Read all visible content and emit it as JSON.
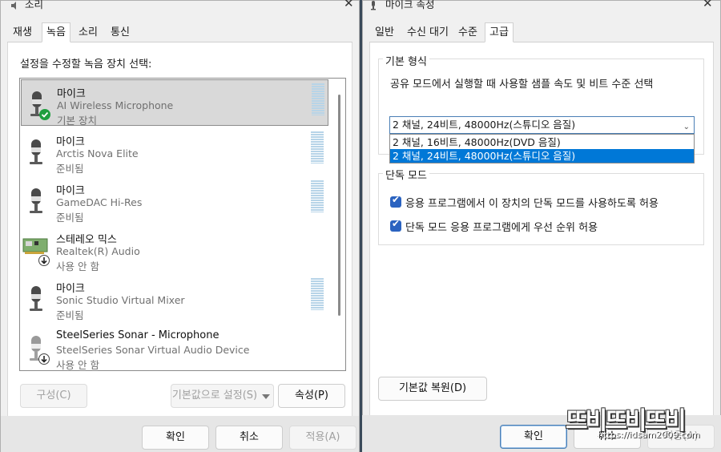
{
  "sound_window": {
    "title": "소리",
    "tabs": [
      {
        "label": "재생"
      },
      {
        "label": "녹음",
        "active": true
      },
      {
        "label": "소리"
      },
      {
        "label": "통신"
      }
    ],
    "prompt": "설정을 수정할 녹음 장치 선택:",
    "devices": [
      {
        "name": "마이크",
        "description": "AI Wireless Microphone",
        "status": "기본 장치",
        "selected": true,
        "icon": "microphone-icon",
        "badge": "default-check-icon"
      },
      {
        "name": "마이크",
        "description": "Arctis Nova Elite",
        "status": "준비됨",
        "icon": "microphone-icon"
      },
      {
        "name": "마이크",
        "description": "GameDAC Hi-Res",
        "status": "준비됨",
        "icon": "microphone-icon"
      },
      {
        "name": "스테레오 믹스",
        "description": "Realtek(R) Audio",
        "status": "사용 안 함",
        "icon": "sound-card-icon",
        "badge": "disabled-arrow-icon"
      },
      {
        "name": "마이크",
        "description": "Sonic Studio Virtual Mixer",
        "status": "준비됨",
        "icon": "microphone-icon"
      },
      {
        "name": "SteelSeries Sonar - Microphone",
        "description": "SteelSeries Sonar Virtual Audio Device",
        "status": "사용 안 함",
        "icon": "microphone-icon",
        "badge": "disabled-arrow-icon"
      }
    ],
    "buttons": {
      "configure": "구성(C)",
      "set_default": "기본값으로 설정(S)",
      "properties": "속성(P)",
      "ok": "확인",
      "cancel": "취소",
      "apply": "적용(A)"
    }
  },
  "props_window": {
    "title": "마이크 속성",
    "tabs": [
      {
        "label": "일반"
      },
      {
        "label": "수신 대기"
      },
      {
        "label": "수준"
      },
      {
        "label": "고급",
        "active": true
      }
    ],
    "default_format": {
      "title": "기본 형식",
      "description": "공유 모드에서 실행할 때 사용할 샘플 속도 및 비트 수준 선택",
      "selected": "2 채널, 24비트, 48000Hz(스튜디오 음질)",
      "options": [
        "2 채널, 16비트, 48000Hz(DVD 음질)",
        "2 채널, 24비트, 48000Hz(스튜디오 음질)"
      ],
      "highlighted_index": 1
    },
    "exclusive_mode": {
      "title": "단독 모드",
      "allow_exclusive": {
        "label": "응용 프로그램에서 이 장치의 단독 모드를 사용하도록 허용",
        "checked": true
      },
      "give_priority": {
        "label": "단독 모드 응용 프로그램에게 우선 순위 허용",
        "checked": true
      }
    },
    "buttons": {
      "restore_defaults": "기본값 복원(D)",
      "ok": "확인",
      "cancel": "취소",
      "apply": "적용(A)"
    }
  },
  "watermark": {
    "word": "뜨비뜨비뜨비",
    "url": "https://idsam2009.com"
  },
  "colors": {
    "accent": "#0078d7",
    "checkbox": "#2b63c0",
    "level_meter": "#b7d4e8"
  }
}
